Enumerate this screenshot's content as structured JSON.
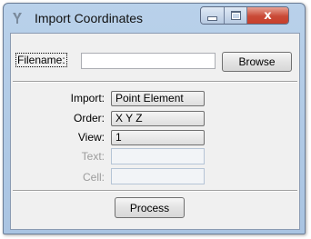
{
  "window": {
    "title": "Import Coordinates",
    "close_glyph": "x",
    "icons": {
      "app": "microstation-icon",
      "minimize": "minimize-icon",
      "maximize": "maximize-icon",
      "close": "close-icon"
    }
  },
  "filename": {
    "label": "Filename:",
    "value": "",
    "browse_label": "Browse"
  },
  "import": {
    "label": "Import:",
    "value": "Point Element"
  },
  "order": {
    "label": "Order:",
    "value": "X Y Z"
  },
  "view": {
    "label": "View:",
    "value": "1"
  },
  "text": {
    "label": "Text:",
    "value": ""
  },
  "cell": {
    "label": "Cell:",
    "value": ""
  },
  "process_label": "Process",
  "colors": {
    "title_bar": "#b9d1ea",
    "close_button": "#c94a37",
    "client_background": "#f0f0f0",
    "disabled_text": "#9c9c9c"
  }
}
